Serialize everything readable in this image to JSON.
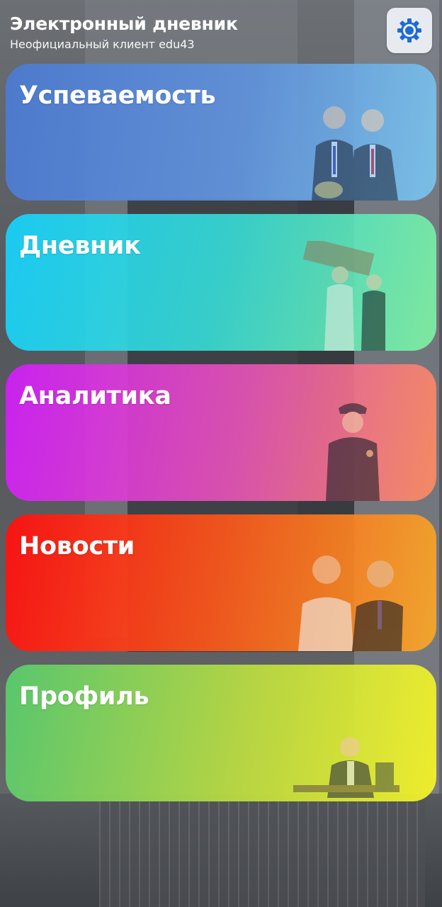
{
  "header": {
    "title": "Электронный дневник",
    "subtitle": "Неофициальный клиент edu43"
  },
  "settings": {
    "icon": "gear-icon",
    "color": "#1e6bd6"
  },
  "menu": [
    {
      "label": "Успеваемость",
      "photo": "two-students-in-suits-photo"
    },
    {
      "label": "Дневник",
      "photo": "students-carrying-box-photo"
    },
    {
      "label": "Аналитика",
      "photo": "student-in-police-uniform-photo"
    },
    {
      "label": "Новости",
      "photo": "two-students-posing-photo"
    },
    {
      "label": "Профиль",
      "photo": "student-on-bench-photo"
    }
  ]
}
